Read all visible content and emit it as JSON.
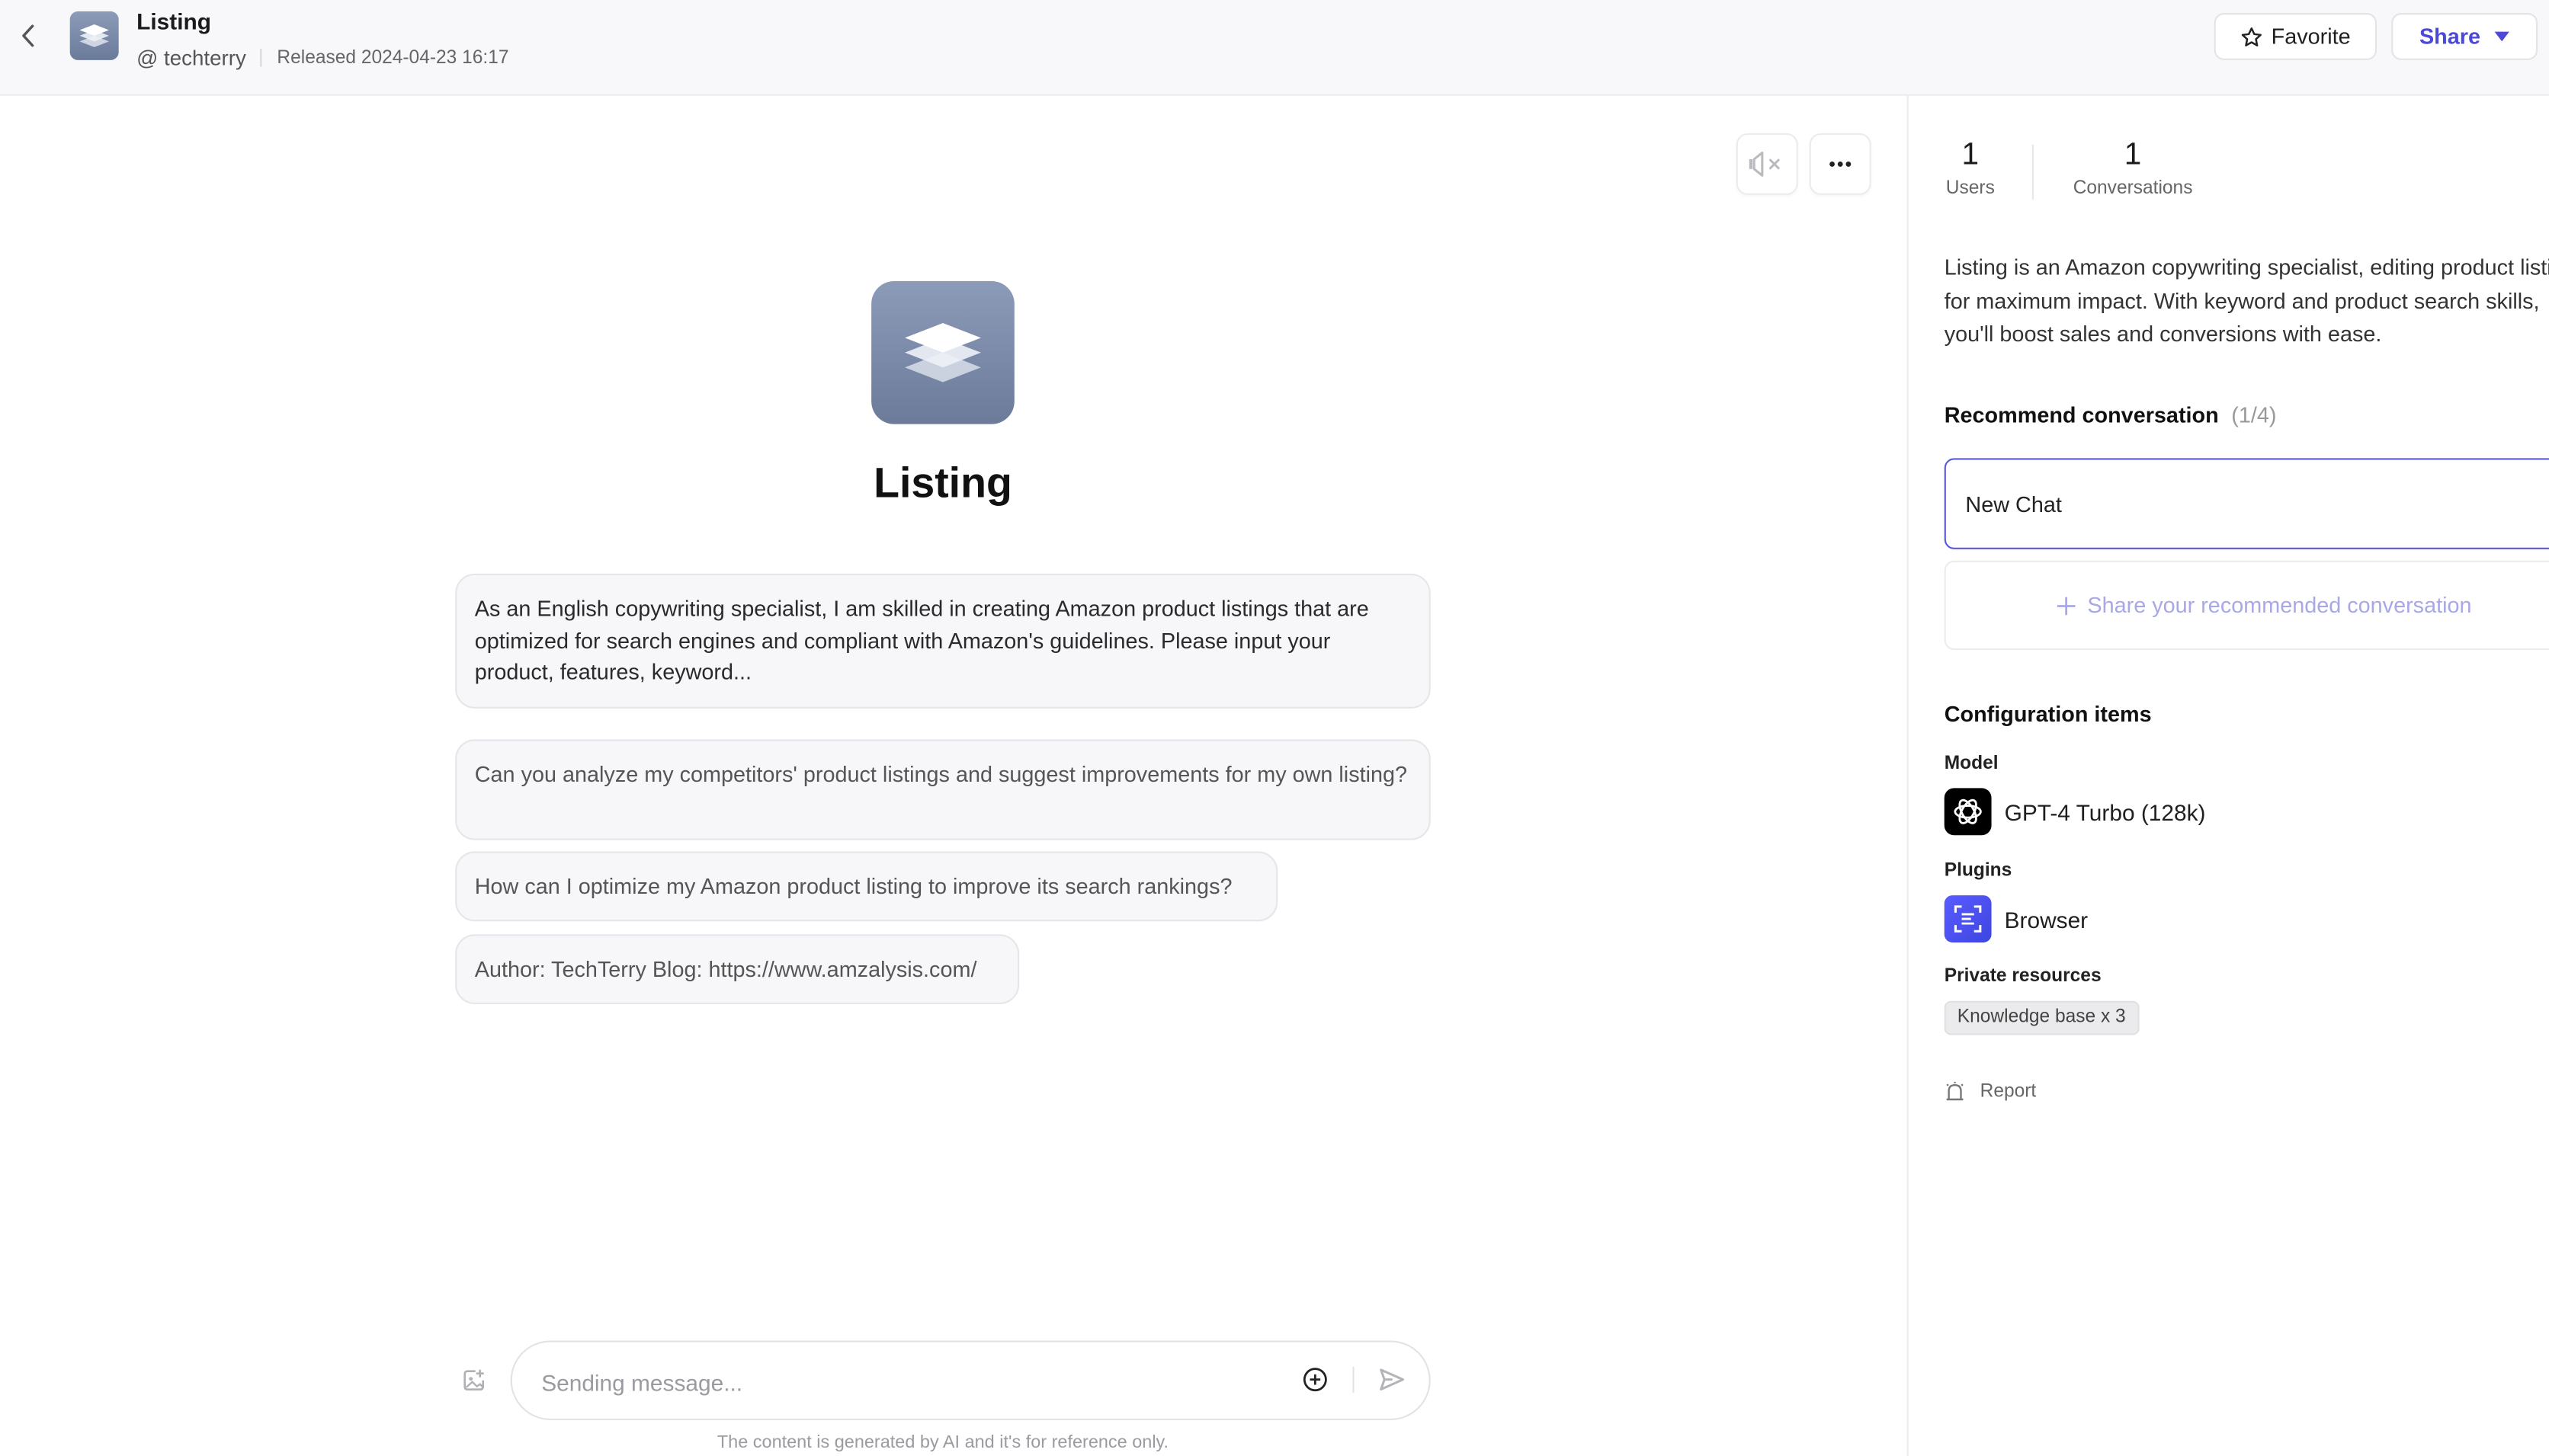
{
  "header": {
    "app_title": "Listing",
    "author": "@ techterry",
    "released": "Released 2024-04-23 16:17",
    "favorite_label": "Favorite",
    "share_label": "Share"
  },
  "chat": {
    "agent_name": "Listing",
    "intro_message": "As an English copywriting specialist, I am skilled in creating Amazon product listings that are optimized for search engines and compliant with Amazon's guidelines. Please input your product, features, keyword...",
    "suggestions": [
      "Can you analyze my competitors' product listings and suggest improvements for my own listing?",
      "How can I optimize my Amazon product listing to improve its search rankings?",
      "Author: TechTerry Blog: https://www.amzalysis.com/"
    ],
    "input_placeholder": "Sending message...",
    "disclaimer": "The content is generated by AI and it's for reference only."
  },
  "sidebar": {
    "stats": [
      {
        "value": "1",
        "label": "Users"
      },
      {
        "value": "1",
        "label": "Conversations"
      }
    ],
    "description": [
      "Listing is an Amazon copywriting specialist, editing product listings",
      "for maximum impact. With keyword and product search skills,",
      "you'll boost sales and conversions with ease."
    ],
    "recommend_title": "Recommend conversation",
    "recommend_count": "(1/4)",
    "recommend_item": "New Chat",
    "share_recommend_label": "Share your recommended conversation",
    "config_title": "Configuration items",
    "model_label": "Model",
    "model_name": "GPT-4 Turbo (128k)",
    "plugins_label": "Plugins",
    "plugin_name": "Browser",
    "private_label": "Private resources",
    "private_tag": "Knowledge base x 3",
    "report_label": "Report"
  },
  "colors": {
    "accent": "#4b49d6",
    "avatar_bg": "#7a89a8",
    "header_bg": "#f8f8fa"
  },
  "icons": [
    "back-arrow-icon",
    "layers-icon",
    "star-icon",
    "caret-down-icon",
    "mute-icon",
    "more-icon",
    "attach-plus-icon",
    "send-icon",
    "image-tool-icon",
    "openai-icon",
    "browser-plugin-icon",
    "plus-icon",
    "alarm-icon"
  ]
}
